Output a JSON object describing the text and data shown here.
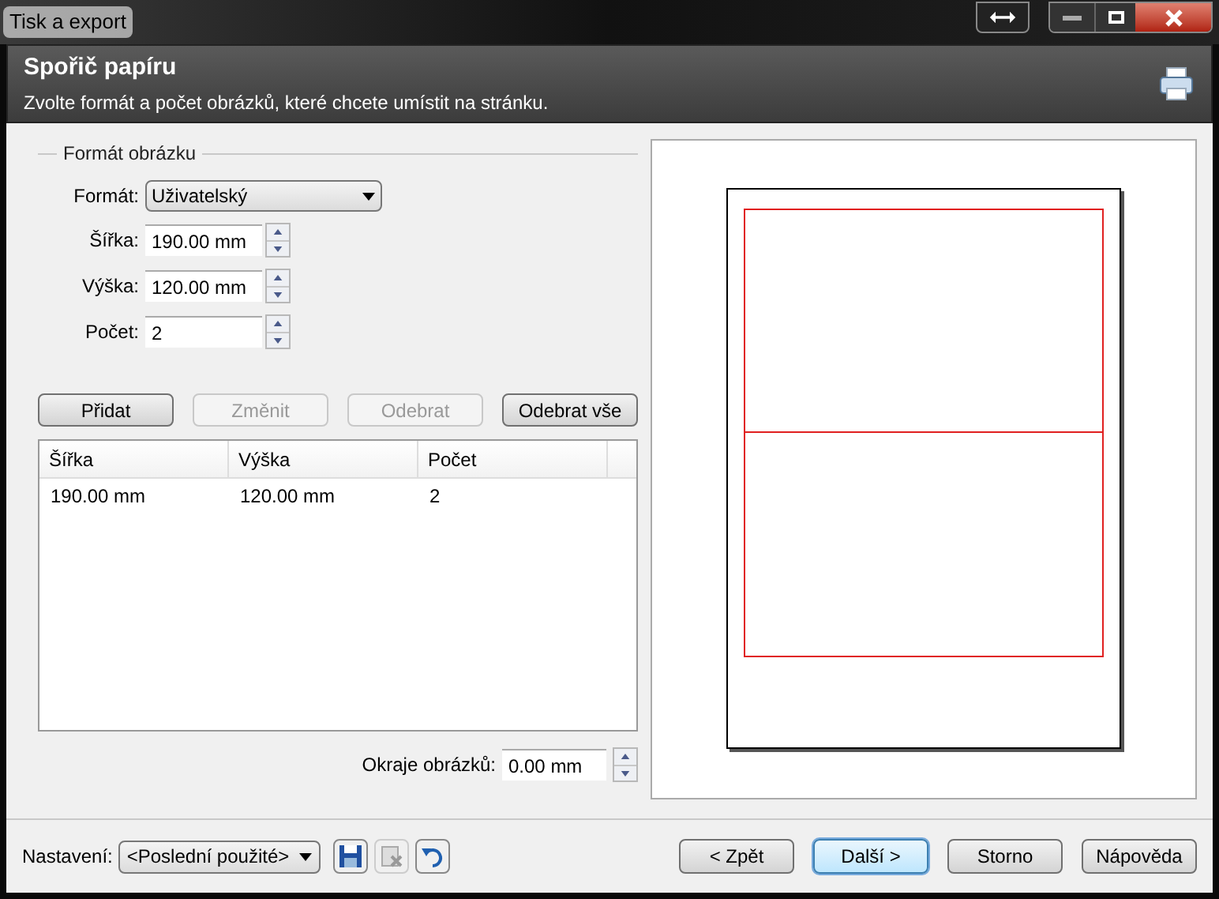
{
  "window": {
    "title": "Tisk a export"
  },
  "header": {
    "title": "Spořič papíru",
    "subtitle": "Zvolte formát a počet obrázků, které chcete umístit na stránku."
  },
  "group": {
    "title": "Formát obrázku"
  },
  "fields": [
    {
      "kind": "select",
      "label": "Formát:",
      "value": "Uživatelský"
    },
    {
      "kind": "spin",
      "label": "Šířka:",
      "value": "190.00 mm"
    },
    {
      "kind": "spin",
      "label": "Výška:",
      "value": "120.00 mm"
    },
    {
      "kind": "spin",
      "label": "Počet:",
      "value": "2"
    }
  ],
  "actions": [
    {
      "label": "Přidat",
      "disabled": false
    },
    {
      "label": "Změnit",
      "disabled": true
    },
    {
      "label": "Odebrat",
      "disabled": true
    },
    {
      "label": "Odebrat vše",
      "disabled": false
    }
  ],
  "table": {
    "columns": [
      "Šířka",
      "Výška",
      "Počet"
    ],
    "rows": [
      [
        "190.00 mm",
        "120.00 mm",
        "2"
      ]
    ]
  },
  "margin": {
    "label": "Okraje obrázků:",
    "value": "0.00 mm"
  },
  "footer": {
    "settings_label": "Nastavení:",
    "settings_value": "<Poslední použité>",
    "buttons": [
      {
        "label": "< Zpět",
        "selected": false
      },
      {
        "label": "Další >",
        "selected": true
      },
      {
        "label": "Storno",
        "selected": false
      },
      {
        "label": "Nápověda",
        "selected": false
      }
    ]
  }
}
